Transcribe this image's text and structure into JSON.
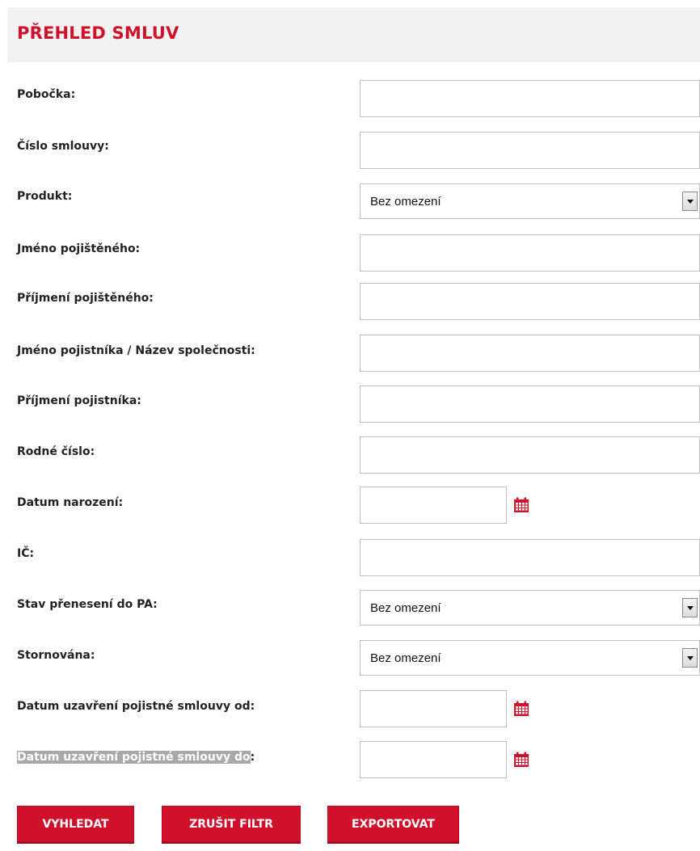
{
  "header": {
    "title": "PŘEHLED SMLUV"
  },
  "fields": [
    {
      "label": "Pobočka:",
      "value": ""
    },
    {
      "label": "Číslo smlouvy:",
      "value": ""
    },
    {
      "label": "Produkt:",
      "value": "Bez omezení"
    },
    {
      "label": "Jméno pojištěného:",
      "value": ""
    },
    {
      "label": "Příjmení pojištěného:",
      "value": ""
    },
    {
      "label": "Jméno pojistníka / Název společnosti:",
      "value": ""
    },
    {
      "label": "Příjmení pojistníka:",
      "value": ""
    },
    {
      "label": "Rodné číslo:",
      "value": ""
    },
    {
      "label": "Datum narození:",
      "value": ""
    },
    {
      "label": "IČ:",
      "value": ""
    },
    {
      "label": "Stav přenesení do PA:",
      "value": "Bez omezení"
    },
    {
      "label": "Stornována:",
      "value": "Bez omezení"
    },
    {
      "label": "Datum uzavření pojistné smlouvy od:",
      "value": ""
    },
    {
      "label_selected": "Datum uzavření pojistné smlouvy do",
      "label_rest": ":",
      "value": ""
    }
  ],
  "icons": {
    "calendar": "calendar-icon",
    "dropdown": "chevron-down-icon"
  },
  "buttons": {
    "search": "VYHLEDAT",
    "clear": "ZRUŠIT FILTR",
    "export": "EXPORTOVAT"
  },
  "colors": {
    "accent": "#d0112b",
    "header_bg": "#f2f2f2",
    "selection": "#a8a8a8"
  }
}
